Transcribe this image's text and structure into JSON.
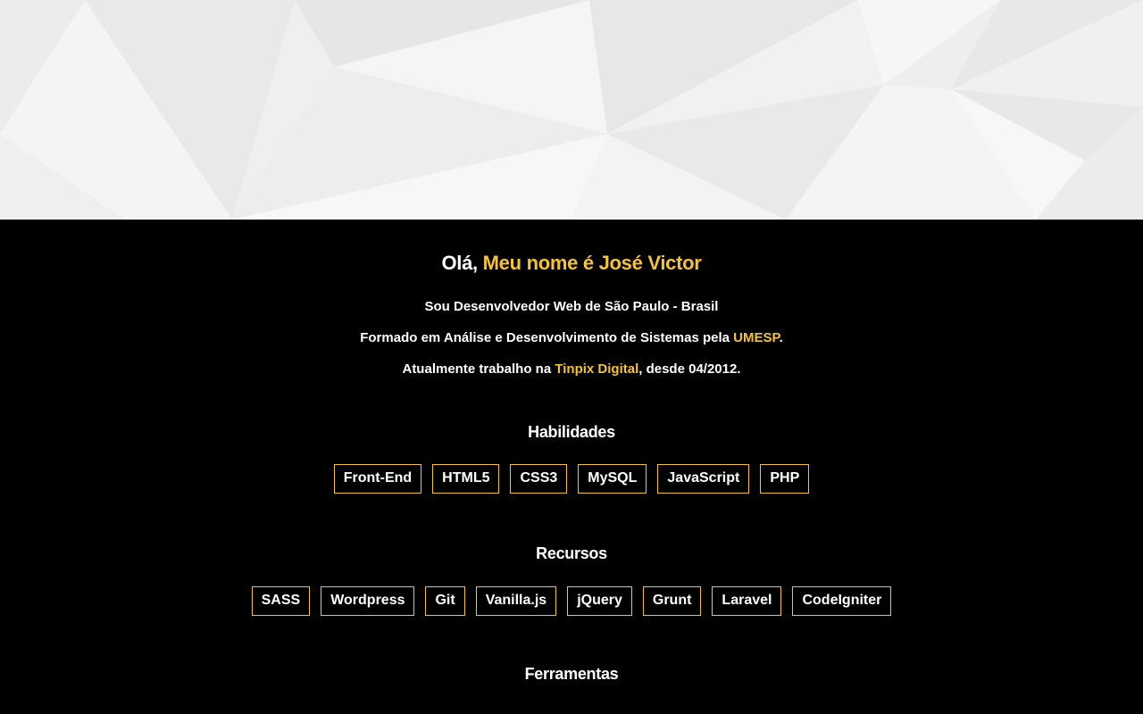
{
  "colors": {
    "accent": "#f6c335",
    "background": "#000000",
    "text": "#ffffff",
    "hero_background": "#f1f1f1"
  },
  "hero": {
    "pattern": "low-poly-gray-triangles"
  },
  "intro": {
    "greeting_prefix": "Olá, ",
    "greeting_name": "Meu nome é José Victor",
    "line1": "Sou Desenvolvedor Web de São Paulo - Brasil",
    "line2_prefix": "Formado em Análise e Desenvolvimento de Sistemas pela ",
    "line2_link": "UMESP",
    "line2_suffix": ".",
    "line3_prefix": "Atualmente trabalho na ",
    "line3_link": "Tinpix Digital",
    "line3_suffix": ", desde 04/2012."
  },
  "skills": {
    "title": "Habilidades",
    "items": [
      "Front-End",
      "HTML5",
      "CSS3",
      "MySQL",
      "JavaScript",
      "PHP"
    ]
  },
  "resources": {
    "title": "Recursos",
    "items": [
      "SASS",
      "Wordpress",
      "Git",
      "Vanilla.js",
      "jQuery",
      "Grunt",
      "Laravel",
      "CodeIgniter"
    ]
  },
  "tools": {
    "title": "Ferramentas"
  }
}
